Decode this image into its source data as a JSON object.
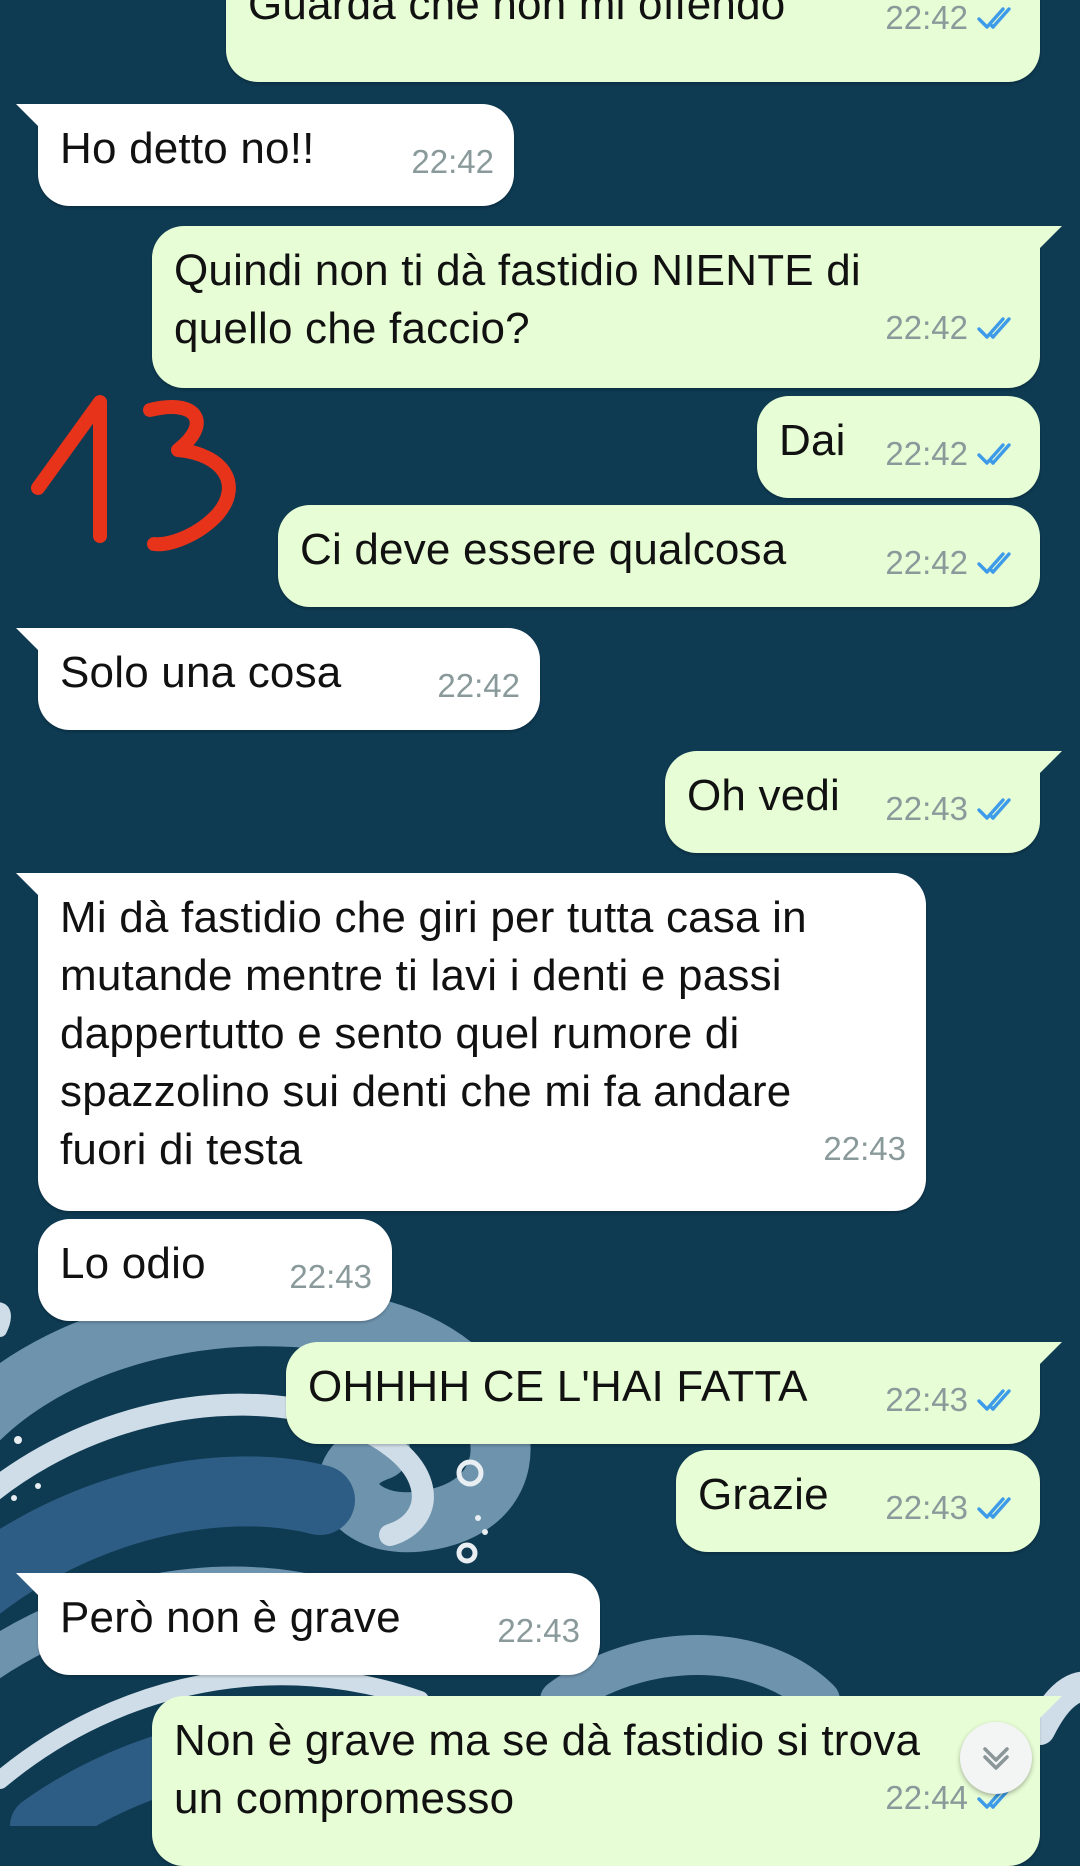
{
  "chat": {
    "messages": [
      {
        "dir": "out",
        "text": "Guarda che non mi offendo",
        "time": "22:42",
        "read": true
      },
      {
        "dir": "in",
        "text": "Ho detto no!!",
        "time": "22:42"
      },
      {
        "dir": "out",
        "text": "Quindi non ti dà fastidio NIENTE di\nquello che faccio?",
        "time": "22:42",
        "read": true
      },
      {
        "dir": "out",
        "text": "Dai",
        "time": "22:42",
        "read": true
      },
      {
        "dir": "out",
        "text": "Ci deve essere qualcosa",
        "time": "22:42",
        "read": true
      },
      {
        "dir": "in",
        "text": "Solo una cosa",
        "time": "22:42"
      },
      {
        "dir": "out",
        "text": "Oh vedi",
        "time": "22:43",
        "read": true
      },
      {
        "dir": "in",
        "text": "Mi dà fastidio che giri per tutta casa in\nmutande mentre ti lavi i denti e passi\ndappertutto e sento quel rumore di\nspazzolino sui denti che mi fa andare\nfuori di testa",
        "time": "22:43"
      },
      {
        "dir": "in",
        "text": "Lo odio",
        "time": "22:43"
      },
      {
        "dir": "out",
        "text": "OHHHH CE L'HAI FATTA",
        "time": "22:43",
        "read": true
      },
      {
        "dir": "out",
        "text": "Grazie",
        "time": "22:43",
        "read": true
      },
      {
        "dir": "in",
        "text": "Però non è grave",
        "time": "22:43"
      },
      {
        "dir": "out",
        "text": "Non è grave ma se dà fastidio si trova\nun compromesso",
        "time": "22:44",
        "read": true
      }
    ]
  },
  "annotation": {
    "text": "13",
    "color": "#e8331b"
  },
  "icons": {
    "read_ticks": "double-check-icon",
    "scroll_down": "chevron-down-icon"
  },
  "colors": {
    "background": "#0e3a52",
    "outgoing_bubble": "#e7fdd5",
    "incoming_bubble": "#ffffff",
    "tick_blue": "#3d9be9",
    "timestamp": "#8a9a9b"
  }
}
